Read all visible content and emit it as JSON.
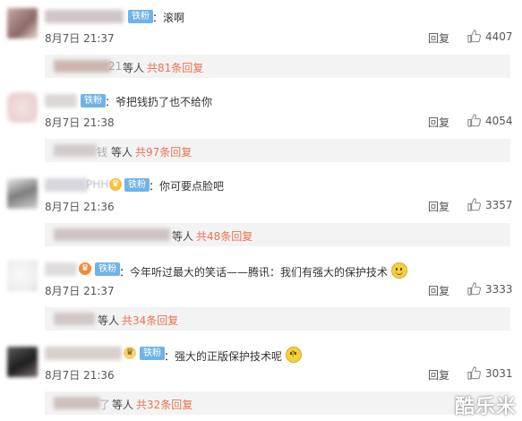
{
  "comments": [
    {
      "badge": "铁粉",
      "text": "：滚啊",
      "time": "8月7日 21:37",
      "reply": "回复",
      "likes": "4407",
      "sub": {
        "tail": "21",
        "prefix": "等人",
        "link": "共81条回复"
      }
    },
    {
      "badge": "铁粉",
      "text": "：爷把钱扔了也不给你",
      "time": "8月7日 21:38",
      "reply": "回复",
      "likes": "4054",
      "sub": {
        "tail": "钱",
        "prefix": "等人",
        "link": "共97条回复"
      }
    },
    {
      "badge": "铁粉",
      "name_tail": "PHH",
      "text": "：你可要点脸吧",
      "time": "8月7日 21:36",
      "reply": "回复",
      "likes": "3357",
      "sub": {
        "tail": "",
        "prefix": "等人",
        "link": "共48条回复"
      }
    },
    {
      "badge": "铁粉",
      "text": "：今年听过最大的笑话——腾讯：我们有强大的保护技术",
      "time": "8月7日 21:37",
      "reply": "回复",
      "likes": "3333",
      "sub": {
        "tail": "",
        "prefix": "等人",
        "link": "共34条回复"
      }
    },
    {
      "badge": "铁粉",
      "text": "：强大的正版保护技术呢",
      "time": "8月7日 21:36",
      "reply": "回复",
      "likes": "3031",
      "sub": {
        "tail": "了",
        "prefix": "等人",
        "link": "共32条回复"
      }
    }
  ],
  "watermark": "酷乐米",
  "icons": {
    "like": "thumbs-up-icon",
    "emoji_smile": "smile-emoji-icon",
    "emoji_think": "thinking-emoji-icon"
  },
  "colors": {
    "badge": "#6fb3e8",
    "link": "#eb7350",
    "sub_bg": "#f3f3f3"
  }
}
